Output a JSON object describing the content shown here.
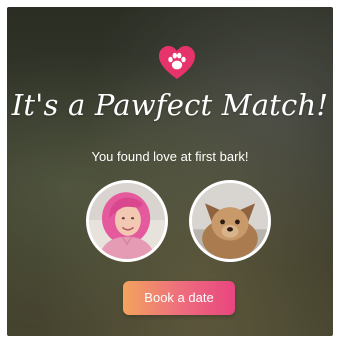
{
  "card": {
    "title": "It's a Pawfect Match!",
    "subtitle": "You found love at first bark!",
    "book_button_label": "Book a date"
  },
  "icons": {
    "badge": "heart-paw-icon",
    "user_avatar": "user-photo",
    "dog_avatar": "dog-photo"
  },
  "colors": {
    "heart": "#e7336b",
    "button_gradient_start": "#f3a35e",
    "button_gradient_end": "#e9457f",
    "text": "#ffffff"
  }
}
